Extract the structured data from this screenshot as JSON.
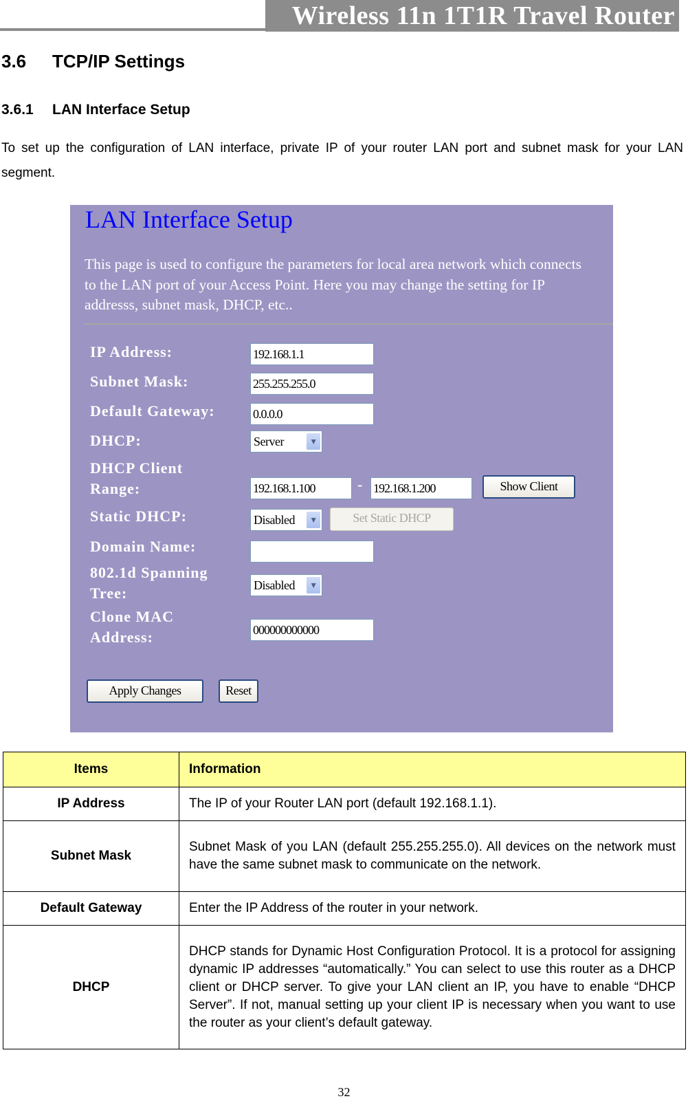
{
  "header": {
    "title": "Wireless 11n 1T1R Travel Router"
  },
  "section": {
    "number": "3.6",
    "title": "TCP/IP Settings"
  },
  "subsection": {
    "number": "3.6.1",
    "title": "LAN Interface Setup"
  },
  "intro": "To set up the configuration of LAN interface, private IP of your router LAN port and subnet mask for your LAN segment.",
  "screenshot": {
    "title": "LAN Interface Setup",
    "description": "This page is used to configure the parameters for local area network which connects to the LAN port of your Access Point. Here you may change the setting for IP addresss, subnet mask, DHCP, etc..",
    "fields": {
      "ip_address": {
        "label": "IP Address:",
        "value": "192.168.1.1"
      },
      "subnet_mask": {
        "label": "Subnet Mask:",
        "value": "255.255.255.0"
      },
      "default_gateway": {
        "label": "Default Gateway:",
        "value": "0.0.0.0"
      },
      "dhcp": {
        "label": "DHCP:",
        "selected": "Server"
      },
      "dhcp_range": {
        "label_line1": "DHCP Client",
        "label_line2": "Range:",
        "start": "192.168.1.100",
        "separator": "-",
        "end": "192.168.1.200",
        "button": "Show Client"
      },
      "static_dhcp": {
        "label": "Static DHCP:",
        "selected": "Disabled",
        "button": "Set Static DHCP"
      },
      "domain_name": {
        "label": "Domain Name:",
        "value": ""
      },
      "spanning_tree": {
        "label_line1": "802.1d Spanning",
        "label_line2": "Tree:",
        "selected": "Disabled"
      },
      "clone_mac": {
        "label_line1": "Clone MAC",
        "label_line2": "Address:",
        "value": "000000000000"
      }
    },
    "buttons": {
      "apply": "Apply Changes",
      "reset": "Reset"
    },
    "icons": {
      "dropdown": "chevron-down-icon"
    }
  },
  "table": {
    "headers": [
      "Items",
      "Information"
    ],
    "rows": [
      {
        "item": "IP Address",
        "info": "The IP of your Router LAN port (default 192.168.1.1)."
      },
      {
        "item": "Subnet Mask",
        "info": "Subnet Mask of you LAN (default 255.255.255.0). All devices on the network must have the same subnet mask to communicate on the network."
      },
      {
        "item": "Default Gateway",
        "info": "Enter the IP Address of the router in your network."
      },
      {
        "item": "DHCP",
        "info": "DHCP stands for Dynamic Host Configuration Protocol. It is a protocol for assigning dynamic IP addresses “automatically.” You can select to use this router as a DHCP client or DHCP server. To give your LAN client an IP, you have to enable “DHCP Server”. If not, manual setting up your client IP is necessary when you want to use the router as your client’s default gateway."
      }
    ]
  },
  "footer": {
    "page_number": "32"
  }
}
